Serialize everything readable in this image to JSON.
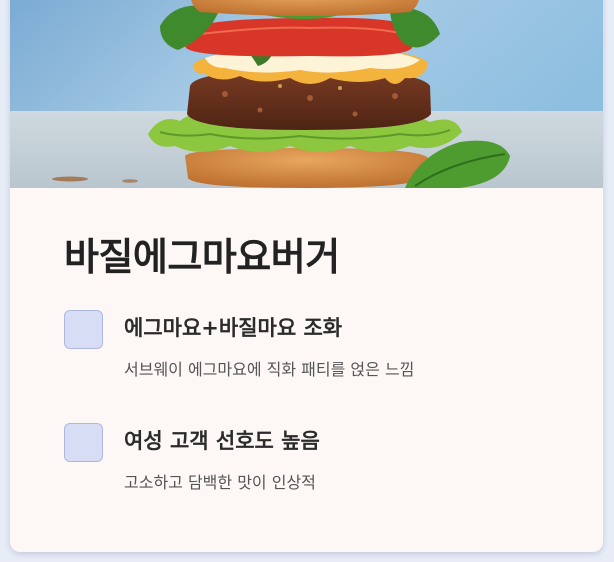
{
  "card": {
    "image_alt": "basil-egg-mayo-burger-photo",
    "title": "바질에그마요버거",
    "features": [
      {
        "title": "에그마요+바질마요 조화",
        "description": "서브웨이 에그마요에 직화 패티를 얹은 느낌"
      },
      {
        "title": "여성 고객 선호도 높음",
        "description": "고소하고 담백한 맛이 인상적"
      }
    ]
  },
  "colors": {
    "page_background": "#e7ecf7",
    "card_background": "#fdf8f6",
    "checkbox_fill": "#d7ddf5",
    "title_text": "#222222"
  }
}
